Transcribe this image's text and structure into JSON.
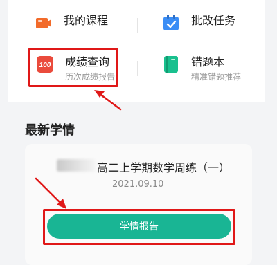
{
  "menu": {
    "courses": {
      "title": "我的课程"
    },
    "grading": {
      "title": "批改任务"
    },
    "scores": {
      "title": "成绩查询",
      "subtitle": "历次成绩报告",
      "icon_text": "100"
    },
    "mistakes": {
      "title": "错题本",
      "subtitle": "精准错题推荐"
    }
  },
  "latest": {
    "section_title": "最新学情",
    "exam_title": "高二上学期数学周练（一）",
    "exam_date": "2021.09.10",
    "report_button": "学情报告"
  },
  "colors": {
    "accent_green": "#19b594",
    "highlight_red": "#e01818",
    "course_orange": "#f26b2a",
    "task_blue": "#3a8df5",
    "score_red": "#ea4b3c",
    "mistake_green": "#19c08e"
  }
}
